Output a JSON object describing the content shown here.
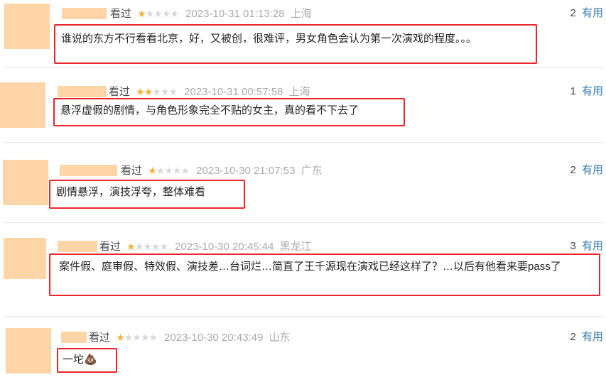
{
  "comments": [
    {
      "status": "看过",
      "rating": 1,
      "time": "2023-10-31 01:13:28",
      "location": "上海",
      "useful_count": "2",
      "useful_label": "有用",
      "content": "谁说的东方不行看看北京，好，又被创，很难评，男女角色会认为第一次演戏的程度。。。"
    },
    {
      "status": "看过",
      "rating": 2,
      "time": "2023-10-31 00:57:58",
      "location": "上海",
      "useful_count": "1",
      "useful_label": "有用",
      "content": "悬浮虚假的剧情，与角色形象完全不贴的女主，真的看不下去了"
    },
    {
      "status": "看过",
      "rating": 1,
      "time": "2023-10-30 21:07:53",
      "location": "广东",
      "useful_count": "2",
      "useful_label": "有用",
      "content": "剧情悬浮，演技浮夸，整体难看"
    },
    {
      "status": "看过",
      "rating": 1,
      "time": "2023-10-30 20:45:44",
      "location": "黑龙江",
      "useful_count": "3",
      "useful_label": "有用",
      "content": "案件假、庭审假、特效假、演技差…台词烂…简直了王千源现在演戏已经这样了？…以后有他看来要pass了"
    },
    {
      "status": "看过",
      "rating": 1,
      "time": "2023-10-30 20:43:49",
      "location": "山东",
      "useful_count": "2",
      "useful_label": "有用",
      "content": "一坨",
      "emoji": "💩"
    }
  ],
  "colors": {
    "highlight_border": "#e8262b",
    "link": "#3377aa",
    "star": "#f4b032",
    "avatar_mask": "#fdd5a6"
  }
}
